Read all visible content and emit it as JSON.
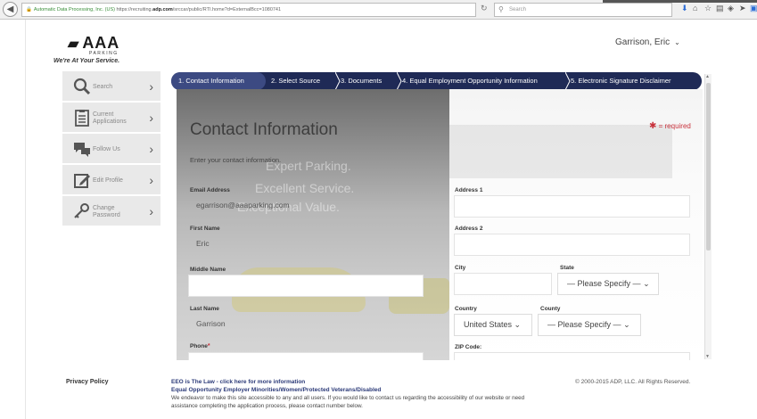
{
  "browser": {
    "url_org": "Automatic Data Processing, Inc. (US)",
    "url_prefix": "https://recruiting.",
    "url_domain": "adp.com",
    "url_path": "/srccar/public/RTI.home?d=ExternalBcc=1080741",
    "search_placeholder": "Search"
  },
  "logo": {
    "brand": "AAA",
    "sub": "PARKING",
    "tagline": "We're At Your Service."
  },
  "user": {
    "name": "Garrison, Eric"
  },
  "sidebar": {
    "items": [
      {
        "label": "Search",
        "icon": "search-icon"
      },
      {
        "label": "Current Applications",
        "icon": "clipboard-icon"
      },
      {
        "label": "Follow Us",
        "icon": "chat-icon"
      },
      {
        "label": "Edit Profile",
        "icon": "edit-icon"
      },
      {
        "label": "Change Password",
        "icon": "key-icon"
      }
    ]
  },
  "tabs": [
    {
      "label": "1. Contact Information",
      "active": true
    },
    {
      "label": "2. Select Source",
      "active": false
    },
    {
      "label": "3. Documents",
      "active": false
    },
    {
      "label": "4. Equal Employment Opportunity Information",
      "active": false
    },
    {
      "label": "5. Electronic Signature Disclaimer",
      "active": false
    }
  ],
  "hero_text": {
    "line1": "Expert Parking.",
    "line2": "Excellent Service.",
    "line3": "Exceptional Value."
  },
  "form": {
    "title": "Contact Information",
    "required_note": "= required",
    "intro": "Enter your contact information.",
    "email_label": "Email Address",
    "email_value": "egarrison@aaaparking.com",
    "first_name_label": "First Name",
    "first_name_value": "Eric",
    "middle_name_label": "Middle Name",
    "middle_name_value": "",
    "last_name_label": "Last Name",
    "last_name_value": "Garrison",
    "phone_label": "Phone",
    "phone_value": "",
    "address1_label": "Address 1",
    "address1_value": "",
    "address2_label": "Address 2",
    "address2_value": "",
    "city_label": "City",
    "city_value": "",
    "state_label": "State",
    "state_value": "— Please Specify —",
    "country_label": "Country",
    "country_value": "United States",
    "county_label": "County",
    "county_value": "— Please Specify —",
    "zip_label": "ZIP Code:",
    "zip_value": ""
  },
  "footer": {
    "privacy": "Privacy Policy",
    "eeo_law": "EEO is The Law - click here for more information",
    "eeo_statement": "Equal Opportunity Employer Minorities/Women/Protected Veterans/Disabled",
    "accessibility": "We endeavor to make this site accessible to any and all users. If you would like to contact us regarding the accessibility of our website or need assistance completing the application process, please contact number below.",
    "copyright": "© 2000-2015 ADP, LLC. All Rights Reserved."
  },
  "colors": {
    "tab_bar": "#1f2a56",
    "tab_active": "#3c4a82",
    "required": "#c8323c",
    "eeo_link": "#2b3a78"
  }
}
